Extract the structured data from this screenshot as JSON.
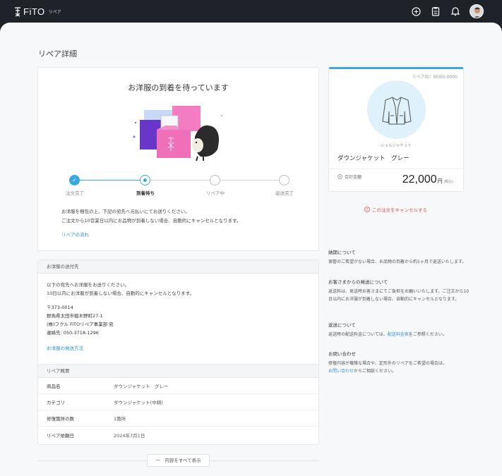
{
  "header": {
    "logo_text": "FiTO",
    "logo_sub": "リペア",
    "icons": [
      "add-circle-icon",
      "clipboard-icon",
      "bell-icon",
      "avatar"
    ]
  },
  "page": {
    "title": "リペア詳細"
  },
  "status": {
    "title": "お洋服の到着を待っています",
    "steps": [
      {
        "label": "注文完了",
        "state": "done"
      },
      {
        "label": "到着待ち",
        "state": "current"
      },
      {
        "label": "リペア中",
        "state": "todo"
      },
      {
        "label": "返送完了",
        "state": "todo"
      }
    ],
    "note_line1": "お洋服を梱包の上、下記の宛先へ元払いにてお送りください。",
    "note_line2": "ご注文から10営業日以内にお品物が到着しない場合、自動的にキャンセルとなります。",
    "flow_link": "リペアの流れ"
  },
  "shipping": {
    "heading": "お洋服の送付先",
    "line1": "以下の宛先へお洋服をお送りください。",
    "line2": "10日以内にお洋服が到着しない場合、自動的にキャンセルとなります。",
    "postal": "〒373-0014",
    "address": "群馬県太田市植木野町27-1",
    "recipient": "(株)フクル FiTOリペア事業部 宛",
    "phone": "連絡先: 050-3718-1296",
    "method_link": "お洋服の発送方法"
  },
  "summary": {
    "heading": "リペア概要",
    "rows": [
      {
        "key": "商品名",
        "value": "ダウンジャケット　グレー"
      },
      {
        "key": "カテゴリ",
        "value": "ダウンジャケット(中綿)"
      },
      {
        "key": "修復箇所の数",
        "value": "1箇所"
      },
      {
        "key": "リペア依頼日",
        "value": "2024年7月1日"
      }
    ],
    "expand_label": "一　内容をすべて表示"
  },
  "product": {
    "repair_id": "リペアID：M000-0000",
    "category": "シェルジャケット",
    "name": "ダウンジャケット　グレー",
    "price_label": "合計金額",
    "price": "22,000",
    "price_unit": "円",
    "price_tax": "(税込)"
  },
  "cancel_label": "この注文をキャンセルする",
  "info": [
    {
      "title": "納期について",
      "text": "保管のご希望がない場合、お品物の到着から約1ヶ月で返送いたします。"
    },
    {
      "title": "お客さまからの発送について",
      "text": "返送料は、発送時お客さまにてご負担をお願いいたします。ご注文から10日以内にお洋服が到着しない場合、自動的にキャンセルとなります。"
    },
    {
      "title": "返送について",
      "text_pre": "返送時の配送料金については、",
      "link": "配送料金表",
      "text_post": "をご参照ください。"
    },
    {
      "title": "お問い合わせ",
      "text": "修復内容が複雑な場合や、定形外のリペアをご希望の場合は、",
      "link": "お問い合わせ",
      "text_post": "からご相談ください。"
    }
  ],
  "colors": {
    "accent": "#3aa7e0",
    "danger": "#d9534f",
    "header_bg": "#1f2329"
  }
}
